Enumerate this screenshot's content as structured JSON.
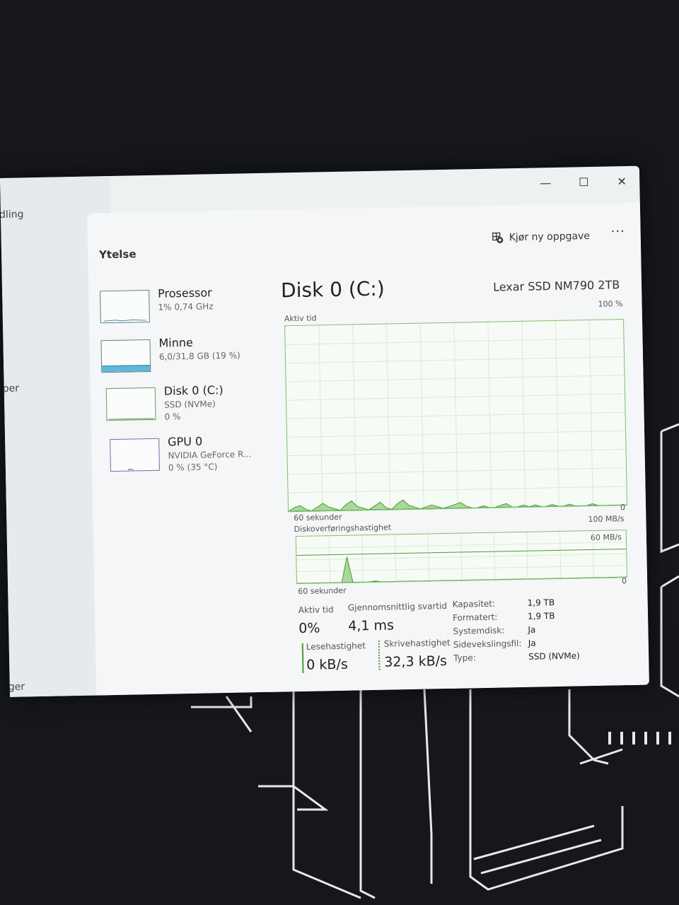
{
  "left_fragments": [
    "dling",
    "per",
    "ger"
  ],
  "window": {
    "buttons": {
      "minimize": "—",
      "maximize": "☐",
      "close": "✕"
    }
  },
  "header": {
    "title": "Ytelse",
    "new_task": "Kjør ny oppgave",
    "more": "···"
  },
  "sidebar": {
    "items": [
      {
        "name": "Prosessor",
        "sub": "1% 0,74 GHz",
        "sub2": ""
      },
      {
        "name": "Minne",
        "sub": "6,0/31,8 GB (19 %)",
        "sub2": ""
      },
      {
        "name": "Disk 0 (C:)",
        "sub": "SSD (NVMe)",
        "sub2": "0 %"
      },
      {
        "name": "GPU 0",
        "sub": "NVIDIA GeForce R...",
        "sub2": "0 % (35 °C)"
      }
    ]
  },
  "main": {
    "title": "Disk 0 (C:)",
    "model": "Lexar SSD NM790 2TB",
    "active_graph": {
      "label": "Aktiv tid",
      "max": "100 %",
      "time": "60 sekunder",
      "min": "0",
      "values": [
        0,
        2,
        3,
        1,
        0,
        2,
        4,
        2,
        1,
        0,
        3,
        5,
        2,
        1,
        0,
        2,
        4,
        1,
        0,
        3,
        5,
        2,
        1,
        0,
        1,
        2,
        1,
        0,
        1,
        2,
        3,
        1,
        0,
        0,
        1,
        0,
        0,
        1,
        2,
        0,
        0,
        1,
        0,
        1,
        0,
        0,
        1,
        0,
        0,
        1,
        0,
        0,
        0,
        1,
        0,
        0,
        0,
        0,
        0,
        0
      ]
    },
    "transfer_graph": {
      "label": "Diskoverføringshastighet",
      "max": "100 MB/s",
      "mid": "60 MB/s",
      "time": "60 sekunder",
      "min": "0",
      "values": [
        0,
        0,
        0,
        0,
        0,
        0,
        0,
        0,
        0,
        55,
        0,
        0,
        0,
        0,
        2,
        0,
        0,
        0,
        0,
        0,
        0,
        0,
        0,
        0,
        0,
        0,
        0,
        0,
        0,
        0,
        0,
        0,
        0,
        0,
        0,
        0,
        0,
        0,
        0,
        0,
        0,
        0,
        0,
        0,
        0,
        0,
        0,
        0,
        0,
        0,
        0,
        0,
        0,
        0,
        0,
        0,
        0,
        0,
        0,
        0
      ]
    },
    "stats": {
      "active_label": "Aktiv tid",
      "active_value": "0%",
      "avg_label": "Gjennomsnittlig svartid",
      "avg_value": "4,1 ms",
      "read_label": "Lesehastighet",
      "read_value": "0 kB/s",
      "write_label": "Skrivehastighet",
      "write_value": "32,3 kB/s"
    },
    "properties": [
      {
        "key": "Kapasitet:",
        "value": "1,9 TB"
      },
      {
        "key": "Formatert:",
        "value": "1,9 TB"
      },
      {
        "key": "Systemdisk:",
        "value": "Ja"
      },
      {
        "key": "Sidevekslingsfil:",
        "value": "Ja"
      },
      {
        "key": "Type:",
        "value": "SSD (NVMe)"
      }
    ]
  }
}
